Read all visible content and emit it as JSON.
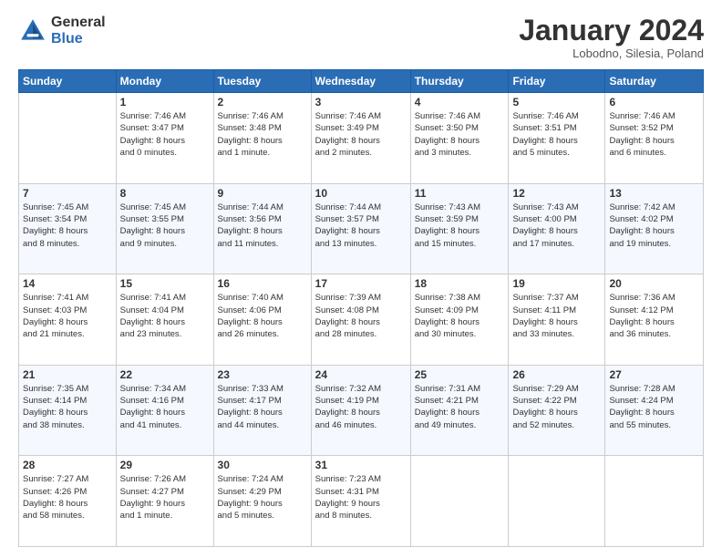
{
  "header": {
    "logo_general": "General",
    "logo_blue": "Blue",
    "month": "January 2024",
    "location": "Lobodno, Silesia, Poland"
  },
  "weekdays": [
    "Sunday",
    "Monday",
    "Tuesday",
    "Wednesday",
    "Thursday",
    "Friday",
    "Saturday"
  ],
  "weeks": [
    [
      {
        "day": "",
        "sunrise": "",
        "sunset": "",
        "daylight": ""
      },
      {
        "day": "1",
        "sunrise": "Sunrise: 7:46 AM",
        "sunset": "Sunset: 3:47 PM",
        "daylight": "Daylight: 8 hours and 0 minutes."
      },
      {
        "day": "2",
        "sunrise": "Sunrise: 7:46 AM",
        "sunset": "Sunset: 3:48 PM",
        "daylight": "Daylight: 8 hours and 1 minute."
      },
      {
        "day": "3",
        "sunrise": "Sunrise: 7:46 AM",
        "sunset": "Sunset: 3:49 PM",
        "daylight": "Daylight: 8 hours and 2 minutes."
      },
      {
        "day": "4",
        "sunrise": "Sunrise: 7:46 AM",
        "sunset": "Sunset: 3:50 PM",
        "daylight": "Daylight: 8 hours and 3 minutes."
      },
      {
        "day": "5",
        "sunrise": "Sunrise: 7:46 AM",
        "sunset": "Sunset: 3:51 PM",
        "daylight": "Daylight: 8 hours and 5 minutes."
      },
      {
        "day": "6",
        "sunrise": "Sunrise: 7:46 AM",
        "sunset": "Sunset: 3:52 PM",
        "daylight": "Daylight: 8 hours and 6 minutes."
      }
    ],
    [
      {
        "day": "7",
        "sunrise": "Sunrise: 7:45 AM",
        "sunset": "Sunset: 3:54 PM",
        "daylight": "Daylight: 8 hours and 8 minutes."
      },
      {
        "day": "8",
        "sunrise": "Sunrise: 7:45 AM",
        "sunset": "Sunset: 3:55 PM",
        "daylight": "Daylight: 8 hours and 9 minutes."
      },
      {
        "day": "9",
        "sunrise": "Sunrise: 7:44 AM",
        "sunset": "Sunset: 3:56 PM",
        "daylight": "Daylight: 8 hours and 11 minutes."
      },
      {
        "day": "10",
        "sunrise": "Sunrise: 7:44 AM",
        "sunset": "Sunset: 3:57 PM",
        "daylight": "Daylight: 8 hours and 13 minutes."
      },
      {
        "day": "11",
        "sunrise": "Sunrise: 7:43 AM",
        "sunset": "Sunset: 3:59 PM",
        "daylight": "Daylight: 8 hours and 15 minutes."
      },
      {
        "day": "12",
        "sunrise": "Sunrise: 7:43 AM",
        "sunset": "Sunset: 4:00 PM",
        "daylight": "Daylight: 8 hours and 17 minutes."
      },
      {
        "day": "13",
        "sunrise": "Sunrise: 7:42 AM",
        "sunset": "Sunset: 4:02 PM",
        "daylight": "Daylight: 8 hours and 19 minutes."
      }
    ],
    [
      {
        "day": "14",
        "sunrise": "Sunrise: 7:41 AM",
        "sunset": "Sunset: 4:03 PM",
        "daylight": "Daylight: 8 hours and 21 minutes."
      },
      {
        "day": "15",
        "sunrise": "Sunrise: 7:41 AM",
        "sunset": "Sunset: 4:04 PM",
        "daylight": "Daylight: 8 hours and 23 minutes."
      },
      {
        "day": "16",
        "sunrise": "Sunrise: 7:40 AM",
        "sunset": "Sunset: 4:06 PM",
        "daylight": "Daylight: 8 hours and 26 minutes."
      },
      {
        "day": "17",
        "sunrise": "Sunrise: 7:39 AM",
        "sunset": "Sunset: 4:08 PM",
        "daylight": "Daylight: 8 hours and 28 minutes."
      },
      {
        "day": "18",
        "sunrise": "Sunrise: 7:38 AM",
        "sunset": "Sunset: 4:09 PM",
        "daylight": "Daylight: 8 hours and 30 minutes."
      },
      {
        "day": "19",
        "sunrise": "Sunrise: 7:37 AM",
        "sunset": "Sunset: 4:11 PM",
        "daylight": "Daylight: 8 hours and 33 minutes."
      },
      {
        "day": "20",
        "sunrise": "Sunrise: 7:36 AM",
        "sunset": "Sunset: 4:12 PM",
        "daylight": "Daylight: 8 hours and 36 minutes."
      }
    ],
    [
      {
        "day": "21",
        "sunrise": "Sunrise: 7:35 AM",
        "sunset": "Sunset: 4:14 PM",
        "daylight": "Daylight: 8 hours and 38 minutes."
      },
      {
        "day": "22",
        "sunrise": "Sunrise: 7:34 AM",
        "sunset": "Sunset: 4:16 PM",
        "daylight": "Daylight: 8 hours and 41 minutes."
      },
      {
        "day": "23",
        "sunrise": "Sunrise: 7:33 AM",
        "sunset": "Sunset: 4:17 PM",
        "daylight": "Daylight: 8 hours and 44 minutes."
      },
      {
        "day": "24",
        "sunrise": "Sunrise: 7:32 AM",
        "sunset": "Sunset: 4:19 PM",
        "daylight": "Daylight: 8 hours and 46 minutes."
      },
      {
        "day": "25",
        "sunrise": "Sunrise: 7:31 AM",
        "sunset": "Sunset: 4:21 PM",
        "daylight": "Daylight: 8 hours and 49 minutes."
      },
      {
        "day": "26",
        "sunrise": "Sunrise: 7:29 AM",
        "sunset": "Sunset: 4:22 PM",
        "daylight": "Daylight: 8 hours and 52 minutes."
      },
      {
        "day": "27",
        "sunrise": "Sunrise: 7:28 AM",
        "sunset": "Sunset: 4:24 PM",
        "daylight": "Daylight: 8 hours and 55 minutes."
      }
    ],
    [
      {
        "day": "28",
        "sunrise": "Sunrise: 7:27 AM",
        "sunset": "Sunset: 4:26 PM",
        "daylight": "Daylight: 8 hours and 58 minutes."
      },
      {
        "day": "29",
        "sunrise": "Sunrise: 7:26 AM",
        "sunset": "Sunset: 4:27 PM",
        "daylight": "Daylight: 9 hours and 1 minute."
      },
      {
        "day": "30",
        "sunrise": "Sunrise: 7:24 AM",
        "sunset": "Sunset: 4:29 PM",
        "daylight": "Daylight: 9 hours and 5 minutes."
      },
      {
        "day": "31",
        "sunrise": "Sunrise: 7:23 AM",
        "sunset": "Sunset: 4:31 PM",
        "daylight": "Daylight: 9 hours and 8 minutes."
      },
      {
        "day": "",
        "sunrise": "",
        "sunset": "",
        "daylight": ""
      },
      {
        "day": "",
        "sunrise": "",
        "sunset": "",
        "daylight": ""
      },
      {
        "day": "",
        "sunrise": "",
        "sunset": "",
        "daylight": ""
      }
    ]
  ]
}
